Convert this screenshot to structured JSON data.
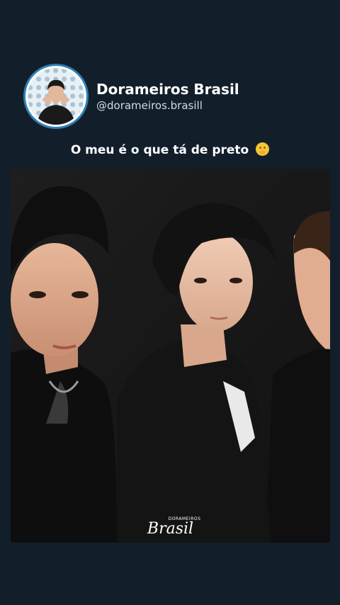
{
  "post": {
    "author": {
      "display_name": "Dorameiros Brasil",
      "handle": "@dorameiros.brasill",
      "avatar_icon": "profile-avatar"
    },
    "caption": "O meu é o que tá de preto",
    "caption_emoji": "face-with-hand-over-mouth-emoji",
    "photo": {
      "watermark_small": "DORAMEIROS",
      "watermark_script": "Brasil"
    }
  },
  "colors": {
    "background": "#121f2b",
    "avatar_ring": "#2f7fb3",
    "text_primary": "#ffffff",
    "text_secondary": "#d3dbe2"
  }
}
